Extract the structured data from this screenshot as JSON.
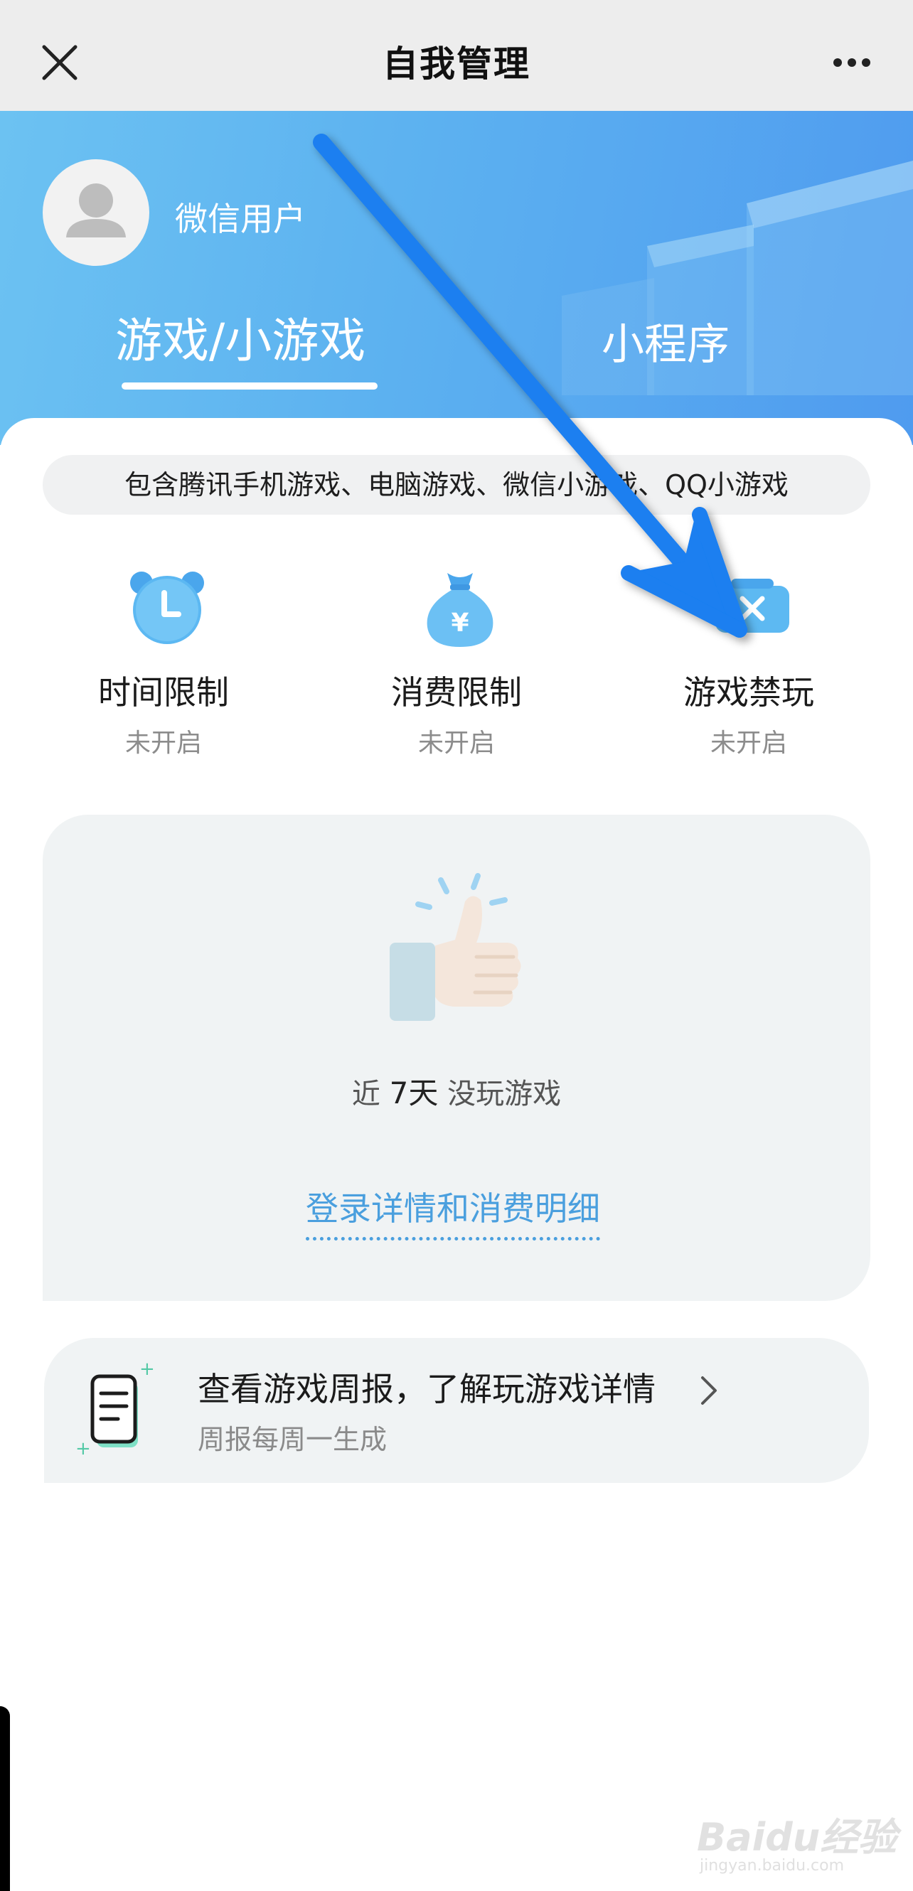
{
  "nav": {
    "title": "自我管理",
    "close_icon": "close-icon",
    "more_icon": "more-icon"
  },
  "header": {
    "username": "微信用户",
    "tabs": [
      {
        "label": "游戏/小游戏",
        "active": true
      },
      {
        "label": "小程序",
        "active": false
      }
    ]
  },
  "coverage_note": "包含腾讯手机游戏、电脑游戏、微信小游戏、QQ小游戏",
  "features": [
    {
      "label": "时间限制",
      "status": "未开启",
      "icon": "alarm-clock-icon"
    },
    {
      "label": "消费限制",
      "status": "未开启",
      "icon": "money-bag-icon"
    },
    {
      "label": "游戏禁玩",
      "status": "未开启",
      "icon": "block-game-icon"
    }
  ],
  "stats": {
    "prefix": "近",
    "days": "7天",
    "suffix": "没玩游戏",
    "link": "登录详情和消费明细",
    "icon": "thumbs-up-icon"
  },
  "report": {
    "title": "查看游戏周报，了解玩游戏详情",
    "subtitle": "周报每周一生成",
    "icon": "report-document-icon"
  },
  "watermark": {
    "brand": "Baidu经验",
    "url": "jingyan.baidu.com"
  },
  "colors": {
    "header_blue": "#5cb1f0",
    "accent_blue": "#4a9fde",
    "annotation_arrow": "#1a7ff0"
  }
}
